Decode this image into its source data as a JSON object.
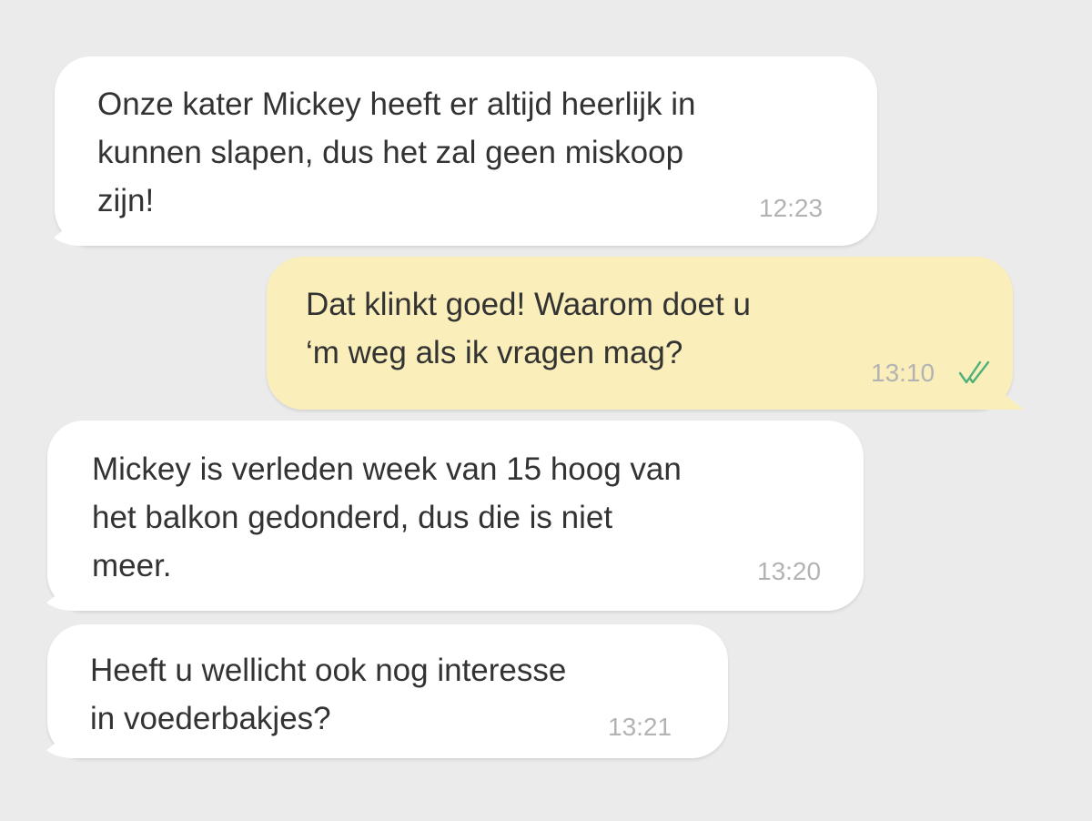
{
  "messages": [
    {
      "direction": "incoming",
      "text": "Onze kater Mickey heeft er altijd heerlijk in\nkunnen slapen, dus het zal geen miskoop\nzijn!",
      "time": "12:23"
    },
    {
      "direction": "outgoing",
      "text": "Dat klinkt goed! Waarom doet u\n‘m weg als ik vragen mag?",
      "time": "13:10",
      "status_icon": "double-check-icon"
    },
    {
      "direction": "incoming",
      "text": "Mickey is verleden week van 15 hoog van\nhet balkon gedonderd, dus die is niet\nmeer.",
      "time": "13:20"
    },
    {
      "direction": "incoming",
      "text": "Heeft u wellicht ook nog interesse\nin voederbakjes?",
      "time": "13:21"
    }
  ],
  "colors": {
    "background": "#ebebeb",
    "incoming_bubble": "#ffffff",
    "outgoing_bubble": "#faeebb",
    "text": "#333333",
    "timestamp": "#b3b3b3",
    "read_check": "#4fb07a"
  }
}
